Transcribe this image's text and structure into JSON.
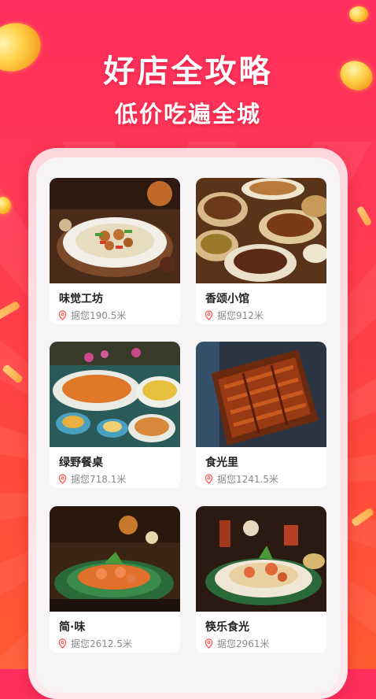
{
  "banner": {
    "title": "好店全攻略",
    "subtitle": "低价吃遍全城"
  },
  "colors": {
    "background_top": "#ff2e5e",
    "background_bottom": "#ff5a32",
    "accent": "#ff4d4d"
  },
  "restaurants": [
    {
      "name": "味觉工坊",
      "distance": "据您190.5米",
      "image": "plated noodles with chicken and peppers"
    },
    {
      "name": "香颂小馆",
      "distance": "据您912米",
      "image": "spread of stew bowls"
    },
    {
      "name": "绿野餐桌",
      "distance": "据您718.1米",
      "image": "seafood feast with sauces"
    },
    {
      "name": "食光里",
      "distance": "据您1241.5米",
      "image": "glazed grilled ribs"
    },
    {
      "name": "简·味",
      "distance": "据您2612.5米",
      "image": "shrimp dish on leaf platter"
    },
    {
      "name": "筷乐食光",
      "distance": "据您2961米",
      "image": "seafood noodle plate with drinks"
    }
  ]
}
